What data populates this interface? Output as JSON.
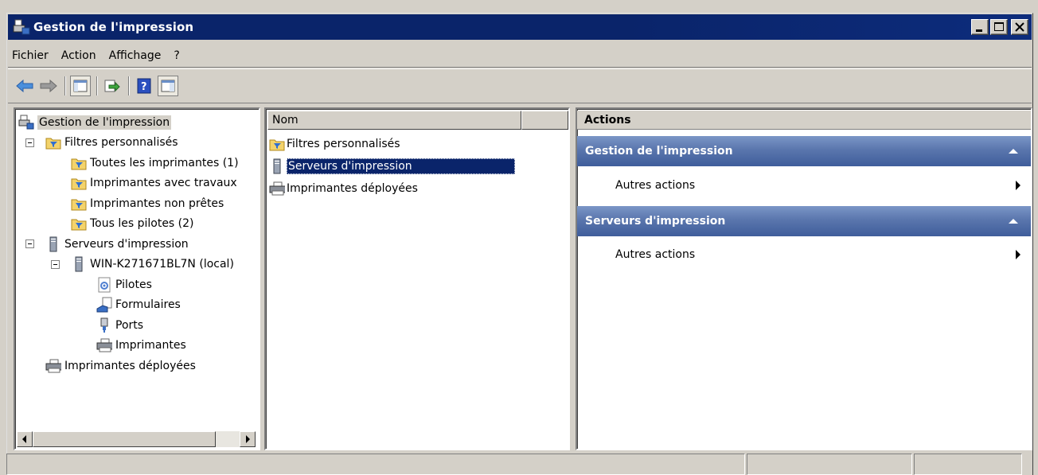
{
  "window": {
    "title": "Gestion de l'impression"
  },
  "menu": [
    "Fichier",
    "Action",
    "Affichage",
    "?"
  ],
  "toolbar": {
    "buttons": [
      "back-arrow-icon",
      "forward-arrow-icon",
      "show-hide-console-tree-icon",
      "export-list-icon",
      "help-icon",
      "show-hide-action-pane-icon"
    ]
  },
  "tree": {
    "root": "Gestion de l'impression",
    "filters": "Filtres personnalisés",
    "filter_items": [
      "Toutes les imprimantes (1)",
      "Imprimantes avec travaux",
      "Imprimantes non prêtes",
      "Tous les pilotes (2)"
    ],
    "servers": "Serveurs d'impression",
    "server_name": "WIN-K271671BL7N (local)",
    "server_items": [
      "Pilotes",
      "Formulaires",
      "Ports",
      "Imprimantes"
    ],
    "deployed": "Imprimantes déployées"
  },
  "list": {
    "column": "Nom",
    "items": [
      "Filtres personnalisés",
      "Serveurs d'impression",
      "Imprimantes déployées"
    ],
    "selected_index": 1
  },
  "actions": {
    "header": "Actions",
    "sections": [
      {
        "title": "Gestion de l'impression",
        "item": "Autres actions"
      },
      {
        "title": "Serveurs d'impression",
        "item": "Autres actions"
      }
    ]
  },
  "colors": {
    "titlebar": "#0a246a",
    "selection": "#0a246a",
    "section_header": "#4d6aa6",
    "chrome": "#d4d0c8"
  }
}
